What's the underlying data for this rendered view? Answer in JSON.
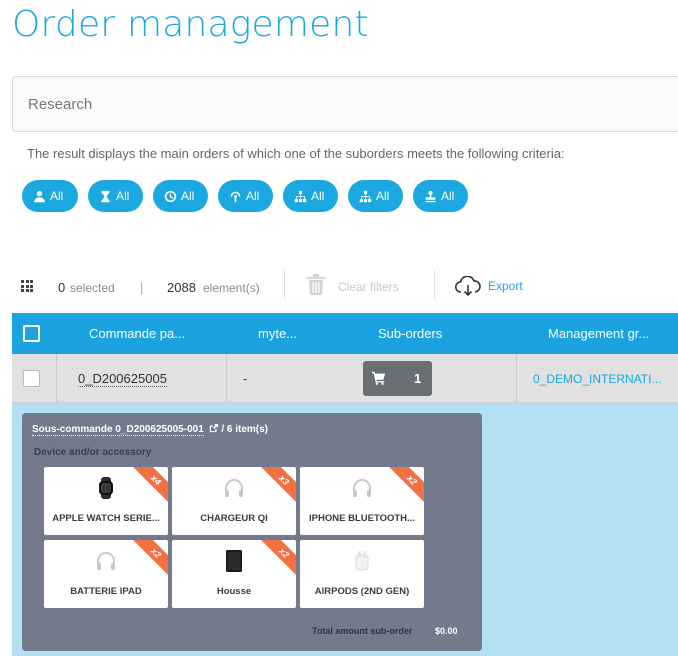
{
  "page": {
    "title": "Order management"
  },
  "search": {
    "placeholder": "Research"
  },
  "criteria_text": "The result displays the main orders of which one of the suborders meets the following criteria:",
  "filters": [
    {
      "icon": "user-icon",
      "label": "All"
    },
    {
      "icon": "hourglass-icon",
      "label": "All"
    },
    {
      "icon": "clock-icon",
      "label": "All"
    },
    {
      "icon": "signal-icon",
      "label": "All"
    },
    {
      "icon": "sitemap-icon",
      "label": "All"
    },
    {
      "icon": "sitemap-icon",
      "label": "All"
    },
    {
      "icon": "stamp-icon",
      "label": "All"
    }
  ],
  "toolbar": {
    "selected_count": "0",
    "selected_label": "selected",
    "separator": "|",
    "element_count": "2088",
    "element_label": "element(s)",
    "clear_filters": "Clear filters",
    "export": "Export"
  },
  "table": {
    "columns": [
      "Commande pa...",
      "myte...",
      "Sub-orders",
      "Management gr..."
    ],
    "rows": [
      {
        "order": "0_D200625005",
        "mytec": "-",
        "suborders": "1",
        "group": "0_DEMO_INTERNATI..."
      }
    ]
  },
  "suborder": {
    "name": "Sous-commande 0_D200625005-001",
    "items_text": " / 6 item(s)",
    "section_label": "Device and/or accessory",
    "products": [
      {
        "name": "APPLE WATCH SERIE...",
        "qty": "x4",
        "icon": "watch-icon"
      },
      {
        "name": "CHARGEUR QI",
        "qty": "x3",
        "icon": "headphones-icon"
      },
      {
        "name": "IPHONE BLUETOOTH...",
        "qty": "x2",
        "icon": "headphones-icon"
      },
      {
        "name": "BATTERIE IPAD",
        "qty": "x2",
        "icon": "headphones-icon"
      },
      {
        "name": "Housse",
        "qty": "x2",
        "icon": "tablet-case-icon"
      },
      {
        "name": "AIRPODS (2ND GEN)",
        "qty": "",
        "icon": "airpods-icon"
      }
    ],
    "total_label": "Total amount sub-order",
    "total_value": "$0.00"
  },
  "colors": {
    "accent": "#1ba8e0",
    "ribbon": "#f37043",
    "panel": "#727a8c",
    "expanded_bg": "#b3dff2"
  }
}
